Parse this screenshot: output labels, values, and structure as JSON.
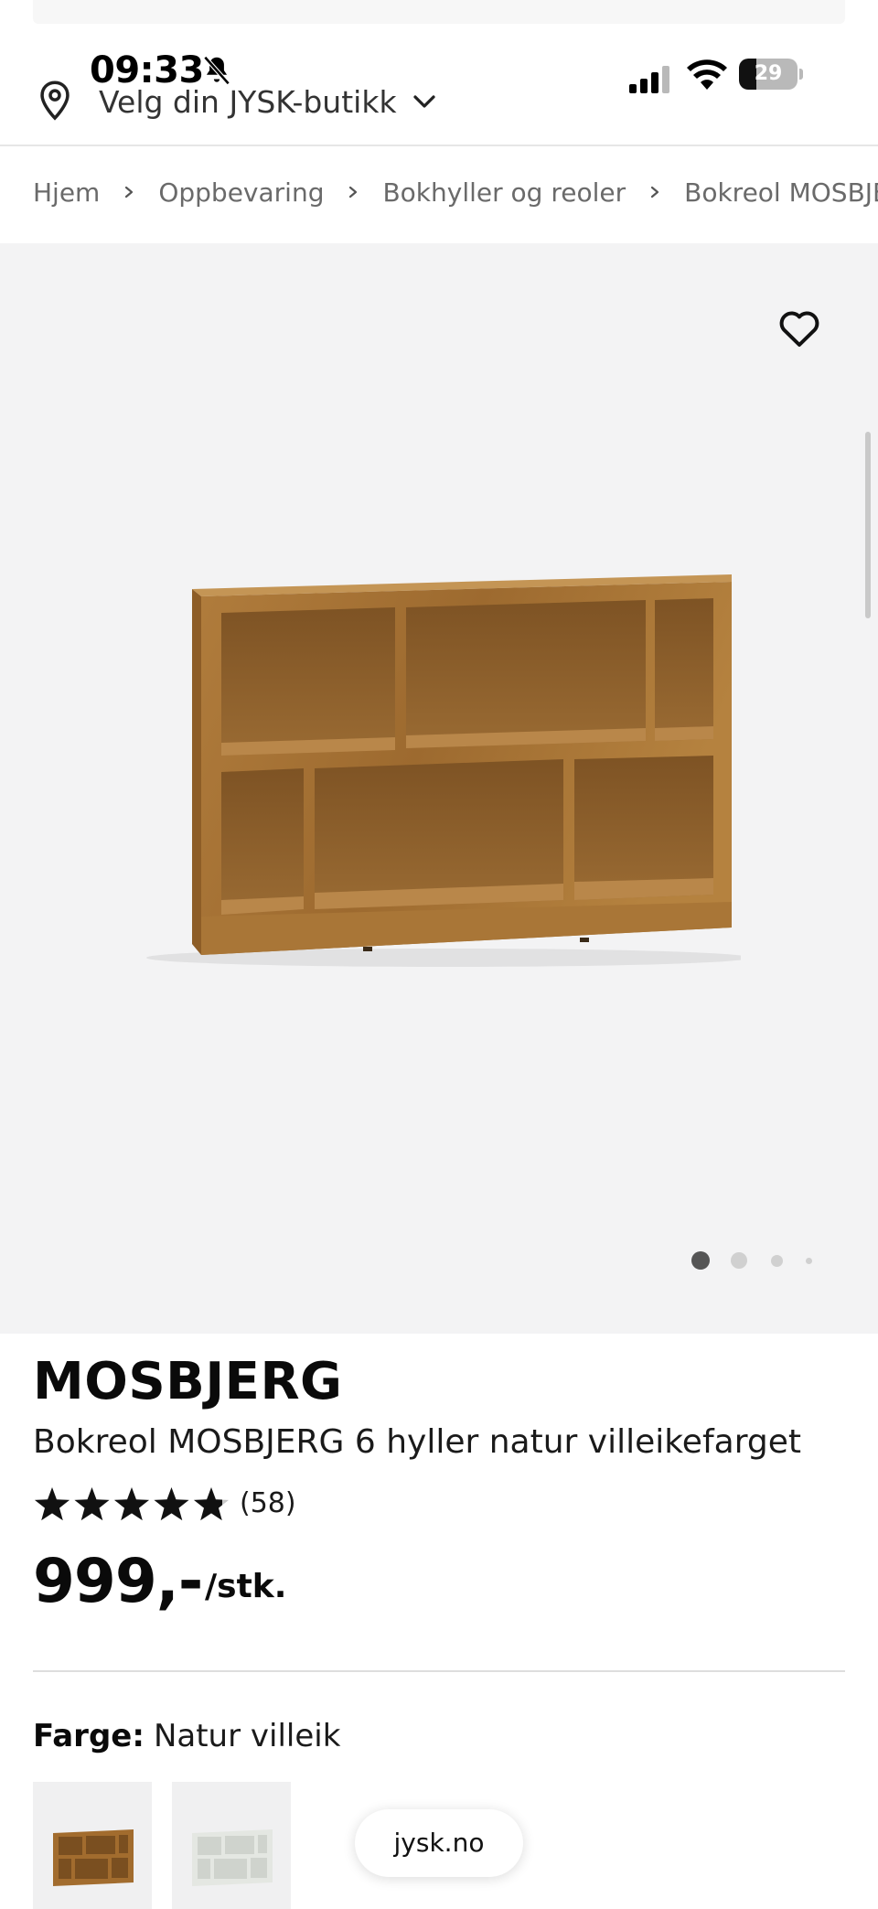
{
  "status_bar": {
    "time": "09:33",
    "battery_level": "29",
    "battery_fraction": 0.29
  },
  "store_selector": {
    "label": "Velg din JYSK-butikk"
  },
  "breadcrumb": {
    "items": [
      "Hjem",
      "Oppbevaring",
      "Bokhyller og reoler",
      "Bokreol MOSBJER"
    ]
  },
  "gallery": {
    "image_count": 4,
    "active_index": 0
  },
  "product": {
    "brand": "MOSBJERG",
    "name": "Bokreol MOSBJERG 6 hyller natur villeikefarget",
    "rating": 4.8,
    "rating_max": 5,
    "review_count": "(58)",
    "price": "999,-",
    "unit": "/stk.",
    "color_label": "Farge:",
    "color_value": "Natur villeik"
  },
  "url_pill": {
    "text": "jysk.no"
  },
  "colors": {
    "gallery_bg": "#f3f3f4",
    "wood": "#a26c2e",
    "text": "#111111",
    "muted": "#6a6a6a"
  }
}
